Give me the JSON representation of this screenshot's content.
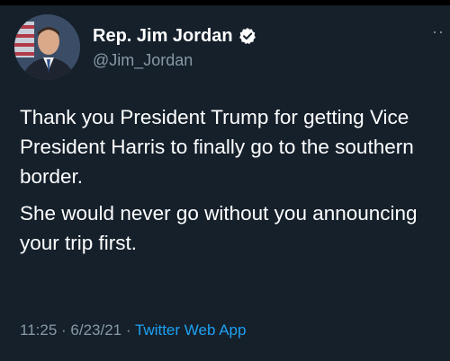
{
  "author": {
    "display_name": "Rep. Jim Jordan",
    "handle": "@Jim_Jordan",
    "verified_icon": "verified-badge-icon"
  },
  "tweet": {
    "paragraphs": [
      "Thank you President Trump for getting Vice President Harris to finally go to the southern border.",
      "She would never go without you announcing your trip first."
    ]
  },
  "meta": {
    "time": "11:25",
    "separator": "·",
    "date": "6/23/21",
    "source": "Twitter Web App"
  },
  "menu": {
    "more_icon": "more-icon",
    "more_glyph": "··"
  },
  "colors": {
    "background": "#15202b",
    "text": "#ffffff",
    "secondary": "#8899a6",
    "accent": "#1da1f2"
  }
}
